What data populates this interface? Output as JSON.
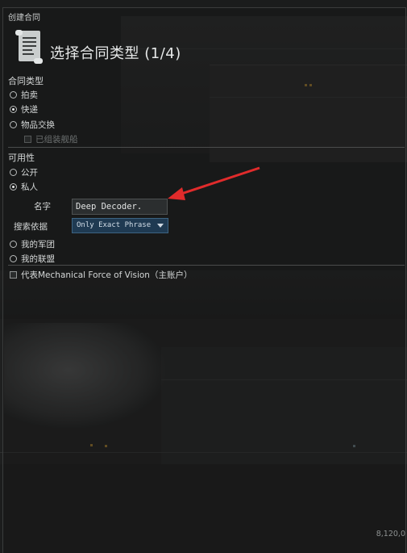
{
  "window": {
    "title": "创建合同"
  },
  "header": {
    "title": "选择合同类型 (1/4)"
  },
  "contract_type": {
    "label": "合同类型",
    "options": [
      {
        "label": "拍卖",
        "checked": false
      },
      {
        "label": "快递",
        "checked": true
      },
      {
        "label": "物品交换",
        "checked": false
      }
    ],
    "assembled_ships": {
      "label": "已组装舰船",
      "checked": false,
      "disabled": true
    }
  },
  "availability": {
    "label": "可用性",
    "options": [
      {
        "label": "公开",
        "checked": false
      },
      {
        "label": "私人",
        "checked": true
      }
    ],
    "name_label": "名字",
    "name_value": "Deep Decoder.",
    "search_label": "搜索依据",
    "search_value": "Only Exact Phrase",
    "corp": {
      "label": "我的军团",
      "checked": false
    },
    "alliance": {
      "label": "我的联盟",
      "checked": false
    }
  },
  "on_behalf": {
    "label": "代表Mechanical Force of Vision（主账户）",
    "checked": false
  },
  "corner_value": "8,120,0",
  "colors": {
    "annotation_arrow": "#e02b2b",
    "select_bg": "#1f3a52"
  },
  "icons": {
    "header": "contract-scroll-icon"
  }
}
